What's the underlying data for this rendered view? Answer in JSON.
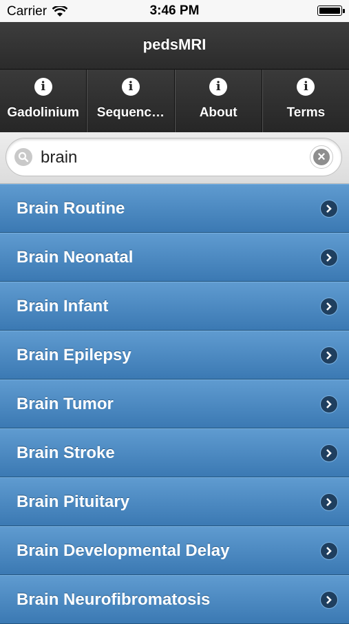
{
  "status_bar": {
    "carrier": "Carrier",
    "time": "3:46 PM"
  },
  "header": {
    "title": "pedsMRI"
  },
  "nav_tabs": [
    {
      "label": "Gadolinium",
      "icon": "info-icon"
    },
    {
      "label": "Sequenc…",
      "icon": "info-icon"
    },
    {
      "label": "About",
      "icon": "info-icon"
    },
    {
      "label": "Terms",
      "icon": "info-icon"
    }
  ],
  "search": {
    "value": "brain"
  },
  "list": [
    {
      "label": "Brain Routine"
    },
    {
      "label": "Brain Neonatal"
    },
    {
      "label": "Brain Infant"
    },
    {
      "label": "Brain Epilepsy"
    },
    {
      "label": "Brain Tumor"
    },
    {
      "label": "Brain Stroke"
    },
    {
      "label": "Brain Pituitary"
    },
    {
      "label": "Brain Developmental Delay"
    },
    {
      "label": "Brain Neurofibromatosis"
    }
  ],
  "colors": {
    "header": "#2b2b2b",
    "list_item": "#4a88c0",
    "search_bg": "#e6e6e6"
  }
}
